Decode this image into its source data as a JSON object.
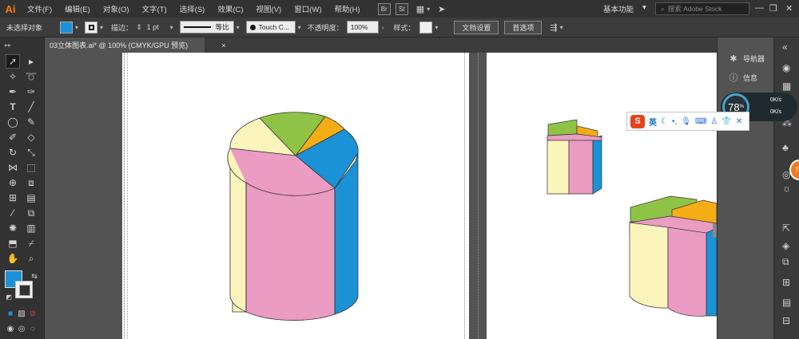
{
  "app": {
    "logo": "Ai"
  },
  "menu": [
    "文件(F)",
    "编辑(E)",
    "对象(O)",
    "文字(T)",
    "选择(S)",
    "效果(C)",
    "视图(V)",
    "窗口(W)",
    "帮助(H)"
  ],
  "menu_apps": {
    "bridge": "Br",
    "stock": "St"
  },
  "workspace_label": "基本功能",
  "search_placeholder": "搜索 Adobe Stock",
  "control_bar": {
    "selection_status": "未选择对象",
    "stroke_label": "描边：",
    "stroke_weight": "1 pt",
    "stroke_profile": "等比",
    "brush": "Touch C...",
    "opacity_label": "不透明度：",
    "opacity_value": "100%",
    "style_label": "样式：",
    "doc_setup_button": "文档设置",
    "preferences_button": "首选项"
  },
  "document_tab": {
    "title": "03立体图表.ai* @ 100% (CMYK/GPU 预览)",
    "close": "×"
  },
  "panels": {
    "navigator": "导航器",
    "info": "信息"
  },
  "speed_widget": {
    "percent": "78",
    "percent_unit": "%",
    "upload": "0K/s",
    "download": "0K/s"
  },
  "badge": "78",
  "ime": {
    "logo": "S",
    "mode": "英"
  },
  "colors": {
    "fill": "#1b91d6",
    "cylinder_pink": "#eb9cc2",
    "cylinder_yellow": "#fbf5bd",
    "cylinder_blue": "#1b91d6",
    "cylinder_green": "#8fc346",
    "cylinder_orange": "#f5ad16"
  },
  "icons": [
    "selection-tool-icon",
    "direct-selection-icon",
    "magic-wand-icon",
    "lasso-icon",
    "pen-icon",
    "curvature-icon",
    "type-icon",
    "line-icon",
    "ellipse-icon",
    "paintbrush-icon",
    "shaper-icon",
    "eraser-icon",
    "rotate-icon",
    "scale-icon",
    "width-icon",
    "free-transform-icon",
    "shape-builder-icon",
    "perspective-icon",
    "mesh-icon",
    "gradient-icon",
    "eyedropper-icon",
    "blend-icon",
    "symbol-sprayer-icon",
    "column-graph-icon",
    "artboard-icon",
    "slice-icon",
    "hand-icon",
    "zoom-icon"
  ]
}
